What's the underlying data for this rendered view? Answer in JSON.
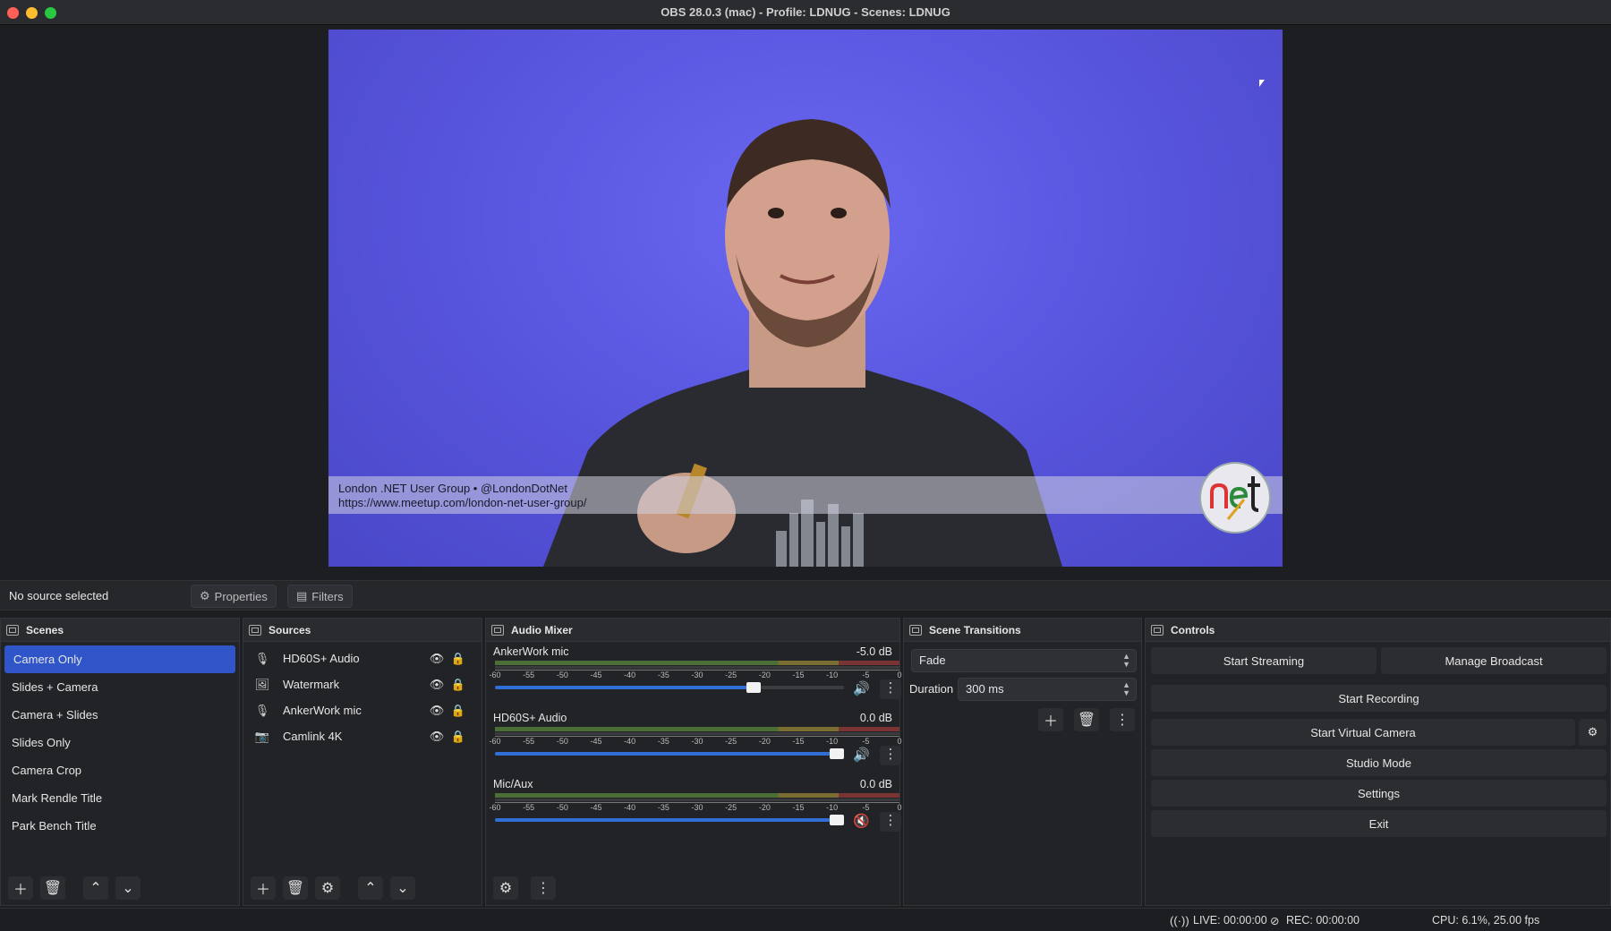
{
  "window": {
    "title": "OBS 28.0.3 (mac) - Profile: LDNUG - Scenes: LDNUG"
  },
  "preview": {
    "lower_third_line1": "London .NET User Group • @LondonDotNet",
    "lower_third_line2": "https://www.meetup.com/london-net-user-group/"
  },
  "source_bar": {
    "status": "No source selected",
    "properties_label": "Properties",
    "filters_label": "Filters"
  },
  "scenes": {
    "title": "Scenes",
    "items": [
      "Camera Only",
      "Slides + Camera",
      "Camera + Slides",
      "Slides Only",
      "Camera Crop",
      "Mark Rendle Title",
      "Park Bench Title"
    ],
    "selected": "Camera Only"
  },
  "sources": {
    "title": "Sources",
    "items": [
      {
        "name": "HD60S+ Audio",
        "icon": "microphone-icon"
      },
      {
        "name": "Watermark",
        "icon": "image-icon"
      },
      {
        "name": "AnkerWork mic",
        "icon": "microphone-icon"
      },
      {
        "name": "Camlink 4K",
        "icon": "camera-icon"
      }
    ]
  },
  "audio_mixer": {
    "title": "Audio Mixer",
    "scale": [
      "-60",
      "-55",
      "-50",
      "-45",
      "-40",
      "-35",
      "-30",
      "-25",
      "-20",
      "-15",
      "-10",
      "-5",
      "0"
    ],
    "channels": [
      {
        "name": "AnkerWork mic",
        "db": "-5.0 dB",
        "level": 0.75,
        "muted": false
      },
      {
        "name": "HD60S+ Audio",
        "db": "0.0 dB",
        "level": 1.0,
        "muted": false
      },
      {
        "name": "Mic/Aux",
        "db": "0.0 dB",
        "level": 1.0,
        "muted": true
      }
    ]
  },
  "scene_transitions": {
    "title": "Scene Transitions",
    "transition": "Fade",
    "duration_label": "Duration",
    "duration": "300 ms"
  },
  "controls": {
    "title": "Controls",
    "start_streaming": "Start Streaming",
    "manage_broadcast": "Manage Broadcast",
    "start_recording": "Start Recording",
    "start_virtual_camera": "Start Virtual Camera",
    "studio_mode": "Studio Mode",
    "settings": "Settings",
    "exit": "Exit"
  },
  "status_bar": {
    "live": "LIVE: 00:00:00",
    "rec": "REC: 00:00:00",
    "cpu": "CPU: 6.1%, 25.00 fps"
  },
  "colors": {
    "accent": "#2f55c8",
    "fader": "#2f6fd6",
    "preview_bg": "#5b58e2"
  }
}
